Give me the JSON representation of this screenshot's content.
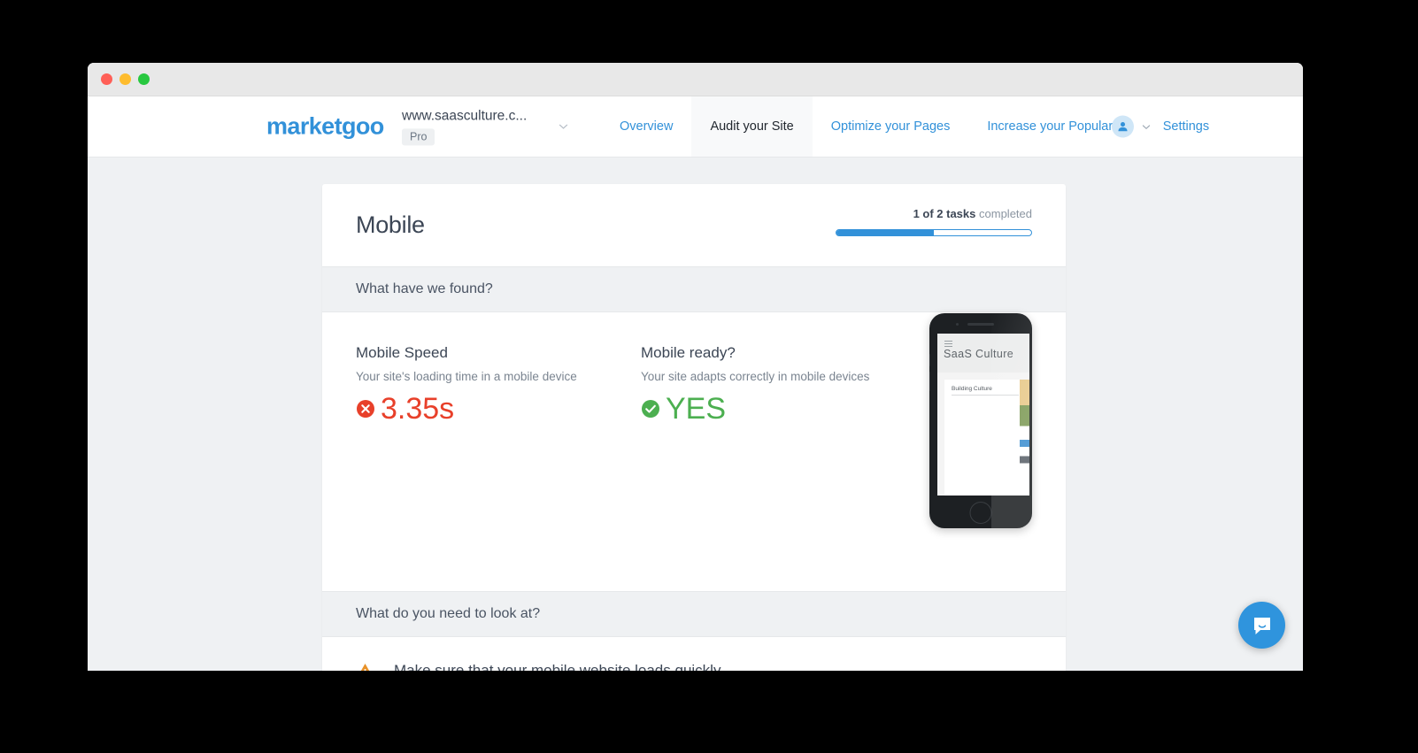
{
  "window": {
    "traffic_lights": [
      "close",
      "minimize",
      "maximize"
    ],
    "colors": {
      "close": "#ff5f57",
      "minimize": "#febc2e",
      "maximize": "#28c840"
    }
  },
  "navbar": {
    "brand": "marketgoo",
    "site": {
      "url": "www.saasculture.c...",
      "plan_badge": "Pro"
    },
    "items": [
      {
        "label": "Overview",
        "active": false
      },
      {
        "label": "Audit your Site",
        "active": true
      },
      {
        "label": "Optimize your Pages",
        "active": false
      },
      {
        "label": "Increase your Popularity",
        "active": false
      },
      {
        "label": "Settings",
        "active": false
      }
    ],
    "accent_color": "#3291d9",
    "active_tab_bg": "#f8f9fa"
  },
  "card": {
    "title": "Mobile",
    "progress": {
      "count_text": "1 of 2 tasks",
      "suffix_text": "completed",
      "percent": 50,
      "bar_color": "#3291d9"
    },
    "found_band": "What have we found?",
    "metrics": [
      {
        "title": "Mobile Speed",
        "subtitle": "Your site's loading time in a mobile device",
        "value": "3.35s",
        "status": "bad",
        "icon": "error-circle-icon",
        "color": "#e8402a"
      },
      {
        "title": "Mobile ready?",
        "subtitle": "Your site adapts correctly in mobile devices",
        "value": "YES",
        "status": "good",
        "icon": "check-circle-icon",
        "color": "#4caf50"
      }
    ],
    "phone_preview": {
      "site_brand": "SaaS Culture",
      "article_title": "Building Culture"
    },
    "lookat_band": "What do you need to look at?",
    "lookat_items": [
      {
        "icon": "warning-triangle-icon",
        "text": "Make sure that your mobile website loads quickly",
        "color": "#e8922a"
      }
    ]
  },
  "intercom": {
    "icon": "chat-bubble-icon",
    "color": "#2f94dd"
  }
}
